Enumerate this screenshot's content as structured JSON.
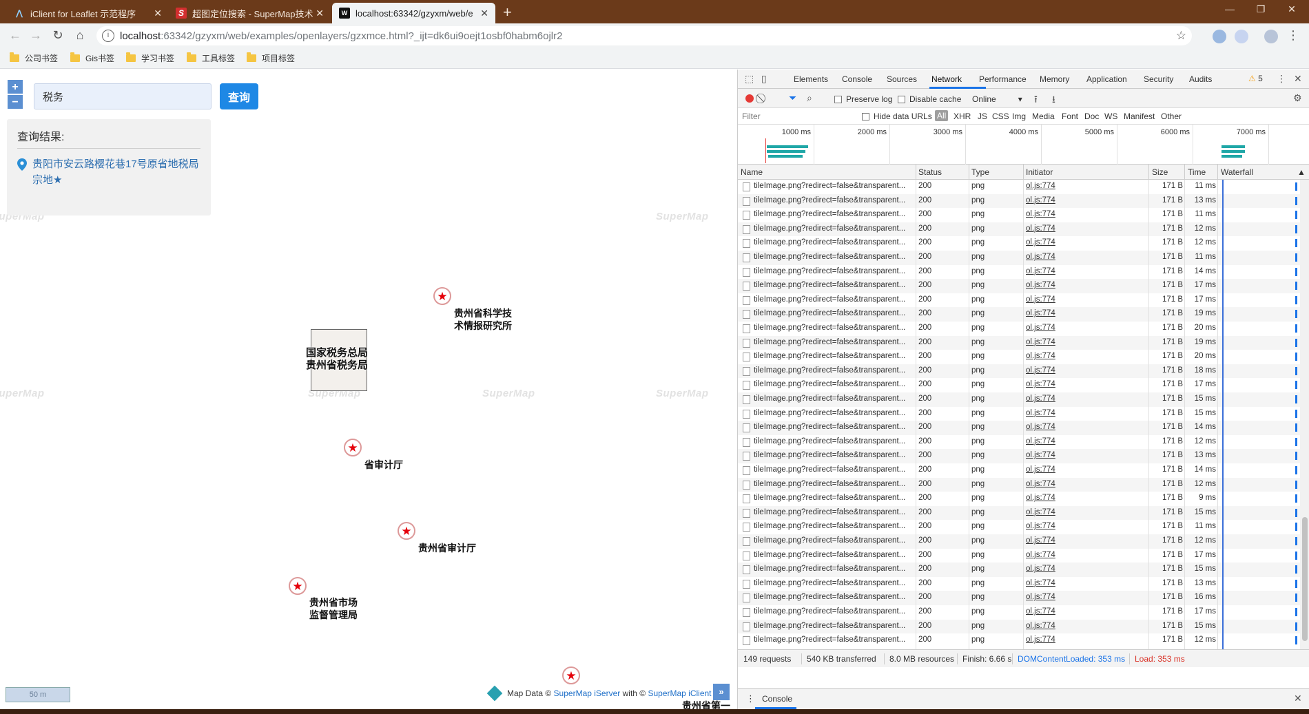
{
  "browser": {
    "tabs": [
      {
        "title": "iClient for Leaflet 示范程序",
        "favicon": "leaflet-icon",
        "active": false
      },
      {
        "title": "超图定位搜索 - SuperMap技术",
        "favicon": "supermap-s-icon",
        "active": false
      },
      {
        "title": "localhost:63342/gzyxm/web/e",
        "favicon": "webstorm-icon",
        "active": true
      }
    ],
    "url_host": "localhost",
    "url_path": ":63342/gzyxm/web/examples/openlayers/gzxmce.html?_ijt=dk6ui9oejt1osbf0habm6ojlr2",
    "bookmarks": [
      "公司书签",
      "Gis书签",
      "学习书签",
      "工具标签",
      "项目标签"
    ]
  },
  "map": {
    "zoom_in": "+",
    "zoom_out": "−",
    "search_value": "税务",
    "search_button": "查询",
    "result_title": "查询结果:",
    "result_item": "贵阳市安云路樱花巷17号原省地税局宗地★",
    "watermark": "SuperMap",
    "pois": [
      {
        "label_line1": "贵州省科学技",
        "label_line2": "术情报研究所"
      },
      {
        "label_line1": "国家税务总局",
        "label_line2": "贵州省税务局"
      },
      {
        "label_line1": "省审计厅",
        "label_line2": ""
      },
      {
        "label_line1": "贵州省审计厅",
        "label_line2": ""
      },
      {
        "label_line1": "贵州省市场",
        "label_line2": "监督管理局"
      },
      {
        "label_line1": "贵州省第一",
        "label_line2": ""
      }
    ],
    "scale": "50 m",
    "attribution": {
      "prefix": "Map Data ©",
      "server": "SuperMap iServer",
      "with": "with ©",
      "client": "SuperMap iClient"
    },
    "attribution_toggle": "»"
  },
  "devtools": {
    "tabs": [
      "Elements",
      "Console",
      "Sources",
      "Network",
      "Performance",
      "Memory",
      "Application",
      "Security",
      "Audits"
    ],
    "active_tab": "Network",
    "warnings": "5",
    "preserve_log": "Preserve log",
    "disable_cache": "Disable cache",
    "throttle": "Online",
    "filter_placeholder": "Filter",
    "hide_data_urls": "Hide data URLs",
    "filter_types": [
      "All",
      "XHR",
      "JS",
      "CSS",
      "Img",
      "Media",
      "Font",
      "Doc",
      "WS",
      "Manifest",
      "Other"
    ],
    "timeline_labels": [
      "1000 ms",
      "2000 ms",
      "3000 ms",
      "4000 ms",
      "5000 ms",
      "6000 ms",
      "7000 ms"
    ],
    "columns": [
      "Name",
      "Status",
      "Type",
      "Initiator",
      "Size",
      "Time",
      "Waterfall"
    ],
    "row_name": "tileImage.png?redirect=false&transparent...",
    "row_status": "200",
    "row_type": "png",
    "row_initiator": "ol.js:774",
    "row_size": "171 B",
    "row_times": [
      "11 ms",
      "13 ms",
      "11 ms",
      "12 ms",
      "12 ms",
      "11 ms",
      "14 ms",
      "17 ms",
      "17 ms",
      "19 ms",
      "20 ms",
      "19 ms",
      "20 ms",
      "18 ms",
      "17 ms",
      "15 ms",
      "15 ms",
      "14 ms",
      "12 ms",
      "13 ms",
      "14 ms",
      "12 ms",
      "9 ms",
      "15 ms",
      "11 ms",
      "12 ms",
      "17 ms",
      "15 ms",
      "13 ms",
      "16 ms",
      "17 ms",
      "15 ms",
      "12 ms"
    ],
    "status": {
      "requests": "149 requests",
      "transferred": "540 KB transferred",
      "resources": "8.0 MB resources",
      "finish": "Finish: 6.66 s",
      "dom": "DOMContentLoaded: 353 ms",
      "load": "Load: 353 ms"
    },
    "drawer_tab": "Console"
  },
  "colors": {
    "tabbar": "#6b3a1a",
    "accent": "#1e88e5",
    "marker": "#e5000a",
    "devtools_blue": "#1a73e8"
  }
}
